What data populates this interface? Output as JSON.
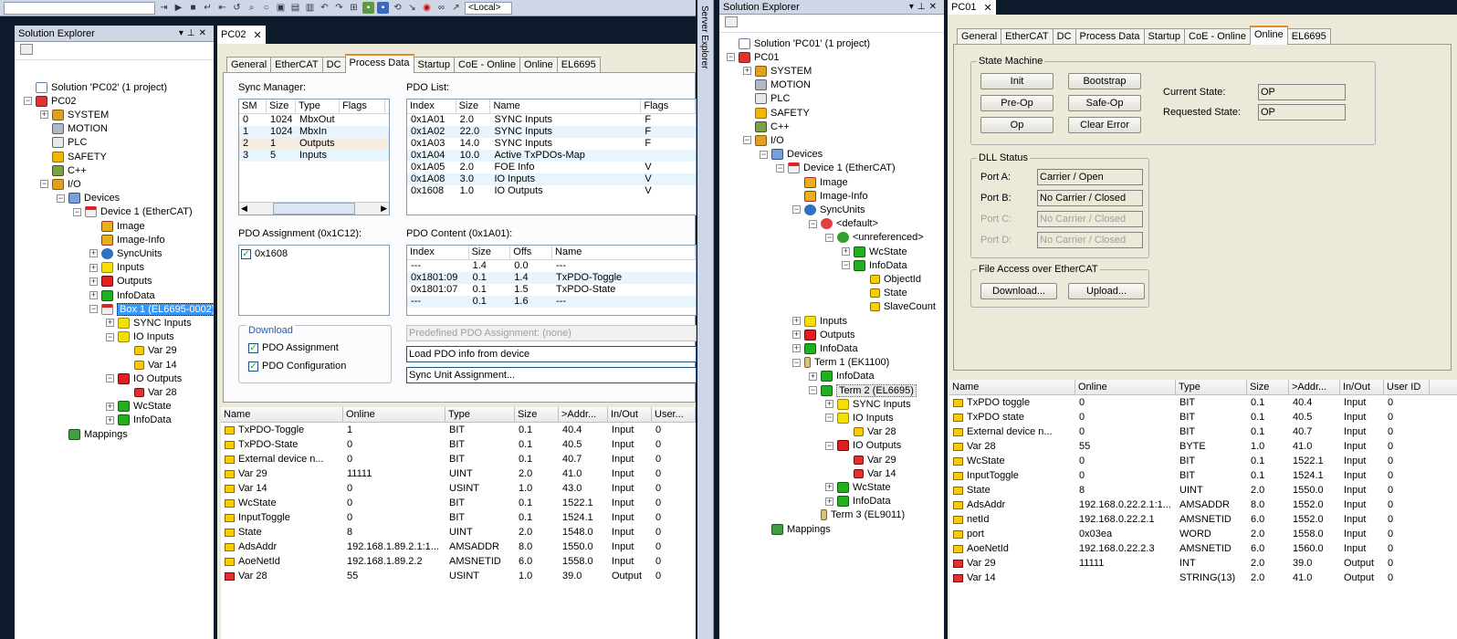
{
  "toolbar": {
    "local_label": "<Local>"
  },
  "left_explorer": {
    "title": "Solution Explorer",
    "items": [
      {
        "label": "Solution 'PC02' (1 project)",
        "depth": 0,
        "icon": "solution-icon",
        "exp": ""
      },
      {
        "label": "PC02",
        "depth": 0,
        "icon": "pc-project-icon",
        "exp": "-"
      },
      {
        "label": "SYSTEM",
        "depth": 1,
        "icon": "system-icon",
        "exp": "+"
      },
      {
        "label": "MOTION",
        "depth": 1,
        "icon": "motion-icon",
        "exp": ""
      },
      {
        "label": "PLC",
        "depth": 1,
        "icon": "plc-icon",
        "exp": ""
      },
      {
        "label": "SAFETY",
        "depth": 1,
        "icon": "safety-icon",
        "exp": ""
      },
      {
        "label": "C++",
        "depth": 1,
        "icon": "cpp-icon",
        "exp": ""
      },
      {
        "label": "I/O",
        "depth": 1,
        "icon": "io-icon",
        "exp": "-"
      },
      {
        "label": "Devices",
        "depth": 2,
        "icon": "devices-icon",
        "exp": "-"
      },
      {
        "label": "Device 1 (EtherCAT)",
        "depth": 3,
        "icon": "ethercat-device-icon",
        "exp": "-"
      },
      {
        "label": "Image",
        "depth": 4,
        "icon": "image-icon",
        "exp": ""
      },
      {
        "label": "Image-Info",
        "depth": 4,
        "icon": "image-info-icon",
        "exp": ""
      },
      {
        "label": "SyncUnits",
        "depth": 4,
        "icon": "syncunits-icon",
        "exp": "+"
      },
      {
        "label": "Inputs",
        "depth": 4,
        "icon": "inputs-icon",
        "exp": "+"
      },
      {
        "label": "Outputs",
        "depth": 4,
        "icon": "outputs-icon",
        "exp": "+"
      },
      {
        "label": "InfoData",
        "depth": 4,
        "icon": "infodata-icon",
        "exp": "+"
      },
      {
        "label": "Box 1 (EL6695-0002)",
        "depth": 4,
        "icon": "box-icon",
        "exp": "-",
        "selected": true
      },
      {
        "label": "SYNC Inputs",
        "depth": 5,
        "icon": "inputs-icon",
        "exp": "+"
      },
      {
        "label": "IO Inputs",
        "depth": 5,
        "icon": "inputs-icon",
        "exp": "-"
      },
      {
        "label": "Var 29",
        "depth": 6,
        "icon": "var-input-icon",
        "exp": ""
      },
      {
        "label": "Var 14",
        "depth": 6,
        "icon": "var-input-icon",
        "exp": ""
      },
      {
        "label": "IO Outputs",
        "depth": 5,
        "icon": "outputs-icon",
        "exp": "-"
      },
      {
        "label": "Var 28",
        "depth": 6,
        "icon": "var-output-icon",
        "exp": ""
      },
      {
        "label": "WcState",
        "depth": 5,
        "icon": "infodata-icon",
        "exp": "+"
      },
      {
        "label": "InfoData",
        "depth": 5,
        "icon": "infodata-icon",
        "exp": "+"
      },
      {
        "label": "Mappings",
        "depth": 2,
        "icon": "mappings-icon",
        "exp": ""
      }
    ]
  },
  "pc02": {
    "doc_tab": "PC02",
    "tabs": [
      "General",
      "EtherCAT",
      "DC",
      "Process Data",
      "Startup",
      "CoE - Online",
      "Online",
      "EL6695"
    ],
    "active_tab": "Process Data",
    "sync_manager": {
      "label": "Sync Manager:",
      "headers": [
        "SM",
        "Size",
        "Type",
        "Flags"
      ],
      "rows": [
        [
          "0",
          "1024",
          "MbxOut",
          ""
        ],
        [
          "1",
          "1024",
          "MbxIn",
          ""
        ],
        [
          "2",
          "1",
          "Outputs",
          ""
        ],
        [
          "3",
          "5",
          "Inputs",
          ""
        ]
      ]
    },
    "pdo_list": {
      "label": "PDO List:",
      "headers": [
        "Index",
        "Size",
        "Name",
        "Flags"
      ],
      "rows": [
        [
          "0x1A01",
          "2.0",
          "SYNC Inputs",
          "F"
        ],
        [
          "0x1A02",
          "22.0",
          "SYNC Inputs",
          "F"
        ],
        [
          "0x1A03",
          "14.0",
          "SYNC Inputs",
          "F"
        ],
        [
          "0x1A04",
          "10.0",
          "Active TxPDOs-Map",
          ""
        ],
        [
          "0x1A05",
          "2.0",
          "FOE Info",
          "V"
        ],
        [
          "0x1A08",
          "3.0",
          "IO Inputs",
          "V"
        ],
        [
          "0x1608",
          "1.0",
          "IO Outputs",
          "V"
        ]
      ]
    },
    "pdo_assignment": {
      "label": "PDO Assignment (0x1C12):",
      "item": "0x1608"
    },
    "pdo_content": {
      "label": "PDO Content (0x1A01):",
      "headers": [
        "Index",
        "Size",
        "Offs",
        "Name"
      ],
      "rows": [
        [
          "---",
          "1.4",
          "0.0",
          "---"
        ],
        [
          "0x1801:09",
          "0.1",
          "1.4",
          "TxPDO-Toggle"
        ],
        [
          "0x1801:07",
          "0.1",
          "1.5",
          "TxPDO-State"
        ],
        [
          "---",
          "0.1",
          "1.6",
          "---"
        ]
      ]
    },
    "download": {
      "title": "Download",
      "pdo_assignment": "PDO Assignment",
      "pdo_configuration": "PDO Configuration"
    },
    "predefined": "Predefined PDO Assignment: (none)",
    "load_pdo": "Load PDO info from device",
    "sync_unit": "Sync Unit Assignment...",
    "grid": {
      "headers": [
        "Name",
        "Online",
        "Type",
        "Size",
        ">Addr...",
        "In/Out",
        "User..."
      ],
      "rows": [
        [
          "TxPDO-Toggle",
          "1",
          "BIT",
          "0.1",
          "40.4",
          "Input",
          "0"
        ],
        [
          "TxPDO-State",
          "0",
          "BIT",
          "0.1",
          "40.5",
          "Input",
          "0"
        ],
        [
          "External device n...",
          "0",
          "BIT",
          "0.1",
          "40.7",
          "Input",
          "0"
        ],
        [
          "Var 29",
          "11111",
          "UINT",
          "2.0",
          "41.0",
          "Input",
          "0"
        ],
        [
          "Var 14",
          "0",
          "USINT",
          "1.0",
          "43.0",
          "Input",
          "0"
        ],
        [
          "WcState",
          "0",
          "BIT",
          "0.1",
          "1522.1",
          "Input",
          "0"
        ],
        [
          "InputToggle",
          "0",
          "BIT",
          "0.1",
          "1524.1",
          "Input",
          "0"
        ],
        [
          "State",
          "8",
          "UINT",
          "2.0",
          "1548.0",
          "Input",
          "0"
        ],
        [
          "AdsAddr",
          "192.168.1.89.2.1:1...",
          "AMSADDR",
          "8.0",
          "1550.0",
          "Input",
          "0"
        ],
        [
          "AoeNetId",
          "192.168.1.89.2.2",
          "AMSNETID",
          "6.0",
          "1558.0",
          "Input",
          "0"
        ],
        [
          "Var 28",
          "55",
          "USINT",
          "1.0",
          "39.0",
          "Output",
          "0"
        ]
      ]
    }
  },
  "server_explorer": "Server Explorer",
  "right_explorer": {
    "title": "Solution Explorer",
    "items": [
      {
        "label": "Solution 'PC01' (1 project)",
        "depth": 0,
        "icon": "solution-icon",
        "exp": ""
      },
      {
        "label": "PC01",
        "depth": 0,
        "icon": "pc-project-icon",
        "exp": "-"
      },
      {
        "label": "SYSTEM",
        "depth": 1,
        "icon": "system-icon",
        "exp": "+"
      },
      {
        "label": "MOTION",
        "depth": 1,
        "icon": "motion-icon",
        "exp": ""
      },
      {
        "label": "PLC",
        "depth": 1,
        "icon": "plc-icon",
        "exp": ""
      },
      {
        "label": "SAFETY",
        "depth": 1,
        "icon": "safety-icon",
        "exp": ""
      },
      {
        "label": "C++",
        "depth": 1,
        "icon": "cpp-icon",
        "exp": ""
      },
      {
        "label": "I/O",
        "depth": 1,
        "icon": "io-icon",
        "exp": "-"
      },
      {
        "label": "Devices",
        "depth": 2,
        "icon": "devices-icon",
        "exp": "-"
      },
      {
        "label": "Device 1 (EtherCAT)",
        "depth": 3,
        "icon": "ethercat-device-icon",
        "exp": "-"
      },
      {
        "label": "Image",
        "depth": 4,
        "icon": "image-icon",
        "exp": ""
      },
      {
        "label": "Image-Info",
        "depth": 4,
        "icon": "image-info-icon",
        "exp": ""
      },
      {
        "label": "SyncUnits",
        "depth": 4,
        "icon": "syncunits-icon",
        "exp": "-"
      },
      {
        "label": "<default>",
        "depth": 5,
        "icon": "default-syncunit-icon",
        "exp": "-"
      },
      {
        "label": "<unreferenced>",
        "depth": 6,
        "icon": "unreferenced-icon",
        "exp": "-"
      },
      {
        "label": "WcState",
        "depth": 7,
        "icon": "infodata-icon",
        "exp": "+"
      },
      {
        "label": "InfoData",
        "depth": 7,
        "icon": "infodata-icon",
        "exp": "-"
      },
      {
        "label": "ObjectId",
        "depth": 8,
        "icon": "var-input-icon",
        "exp": ""
      },
      {
        "label": "State",
        "depth": 8,
        "icon": "var-input-icon",
        "exp": ""
      },
      {
        "label": "SlaveCount",
        "depth": 8,
        "icon": "var-input-icon",
        "exp": ""
      },
      {
        "label": "Inputs",
        "depth": 4,
        "icon": "inputs-icon",
        "exp": "+"
      },
      {
        "label": "Outputs",
        "depth": 4,
        "icon": "outputs-icon",
        "exp": "+"
      },
      {
        "label": "InfoData",
        "depth": 4,
        "icon": "infodata-icon",
        "exp": "+"
      },
      {
        "label": "Term 1 (EK1100)",
        "depth": 4,
        "icon": "terminal-icon",
        "exp": "-"
      },
      {
        "label": "InfoData",
        "depth": 5,
        "icon": "infodata-icon",
        "exp": "+"
      },
      {
        "label": "Term 2 (EL6695)",
        "depth": 5,
        "icon": "infodata-icon",
        "exp": "-",
        "selected": true
      },
      {
        "label": "SYNC Inputs",
        "depth": 6,
        "icon": "inputs-icon",
        "exp": "+"
      },
      {
        "label": "IO Inputs",
        "depth": 6,
        "icon": "inputs-icon",
        "exp": "-"
      },
      {
        "label": "Var 28",
        "depth": 7,
        "icon": "var-input-icon",
        "exp": ""
      },
      {
        "label": "IO Outputs",
        "depth": 6,
        "icon": "outputs-icon",
        "exp": "-"
      },
      {
        "label": "Var 29",
        "depth": 7,
        "icon": "var-output-icon",
        "exp": ""
      },
      {
        "label": "Var 14",
        "depth": 7,
        "icon": "var-output-icon",
        "exp": ""
      },
      {
        "label": "WcState",
        "depth": 6,
        "icon": "infodata-icon",
        "exp": "+"
      },
      {
        "label": "InfoData",
        "depth": 6,
        "icon": "infodata-icon",
        "exp": "+"
      },
      {
        "label": "Term 3 (EL9011)",
        "depth": 5,
        "icon": "terminal-icon",
        "exp": ""
      },
      {
        "label": "Mappings",
        "depth": 2,
        "icon": "mappings-icon",
        "exp": ""
      }
    ]
  },
  "pc01": {
    "doc_tab": "PC01",
    "tabs": [
      "General",
      "EtherCAT",
      "DC",
      "Process Data",
      "Startup",
      "CoE - Online",
      "Online",
      "EL6695"
    ],
    "active_tab": "Online",
    "state_machine": {
      "title": "State Machine",
      "init": "Init",
      "bootstrap": "Bootstrap",
      "preop": "Pre-Op",
      "safeop": "Safe-Op",
      "op": "Op",
      "clear_error": "Clear Error",
      "current_label": "Current State:",
      "current_value": "OP",
      "requested_label": "Requested State:",
      "requested_value": "OP"
    },
    "dll_status": {
      "title": "DLL Status",
      "ports": [
        {
          "label": "Port A:",
          "value": "Carrier / Open",
          "disabled": false
        },
        {
          "label": "Port B:",
          "value": "No Carrier / Closed",
          "disabled": false
        },
        {
          "label": "Port C:",
          "value": "No Carrier / Closed",
          "disabled": true
        },
        {
          "label": "Port D:",
          "value": "No Carrier / Closed",
          "disabled": true
        }
      ]
    },
    "file_access": {
      "title": "File Access over EtherCAT",
      "download": "Download...",
      "upload": "Upload..."
    },
    "grid": {
      "headers": [
        "Name",
        "Online",
        "Type",
        "Size",
        ">Addr...",
        "In/Out",
        "User ID"
      ],
      "rows": [
        [
          "TxPDO toggle",
          "0",
          "BIT",
          "0.1",
          "40.4",
          "Input",
          "0"
        ],
        [
          "TxPDO state",
          "0",
          "BIT",
          "0.1",
          "40.5",
          "Input",
          "0"
        ],
        [
          "External device n...",
          "0",
          "BIT",
          "0.1",
          "40.7",
          "Input",
          "0"
        ],
        [
          "Var 28",
          "55",
          "BYTE",
          "1.0",
          "41.0",
          "Input",
          "0"
        ],
        [
          "WcState",
          "0",
          "BIT",
          "0.1",
          "1522.1",
          "Input",
          "0"
        ],
        [
          "InputToggle",
          "0",
          "BIT",
          "0.1",
          "1524.1",
          "Input",
          "0"
        ],
        [
          "State",
          "8",
          "UINT",
          "2.0",
          "1550.0",
          "Input",
          "0"
        ],
        [
          "AdsAddr",
          "192.168.0.22.2.1:1...",
          "AMSADDR",
          "8.0",
          "1552.0",
          "Input",
          "0"
        ],
        [
          "netId",
          "192.168.0.22.2.1",
          "AMSNETID",
          "6.0",
          "1552.0",
          "Input",
          "0"
        ],
        [
          "port",
          "0x03ea",
          "WORD",
          "2.0",
          "1558.0",
          "Input",
          "0"
        ],
        [
          "AoeNetId",
          "192.168.0.22.2.3",
          "AMSNETID",
          "6.0",
          "1560.0",
          "Input",
          "0"
        ],
        [
          "Var 29",
          "11111",
          "INT",
          "2.0",
          "39.0",
          "Output",
          "0"
        ],
        [
          "Var 14",
          "",
          "STRING(13)",
          "2.0",
          "41.0",
          "Output",
          "0"
        ]
      ]
    }
  }
}
